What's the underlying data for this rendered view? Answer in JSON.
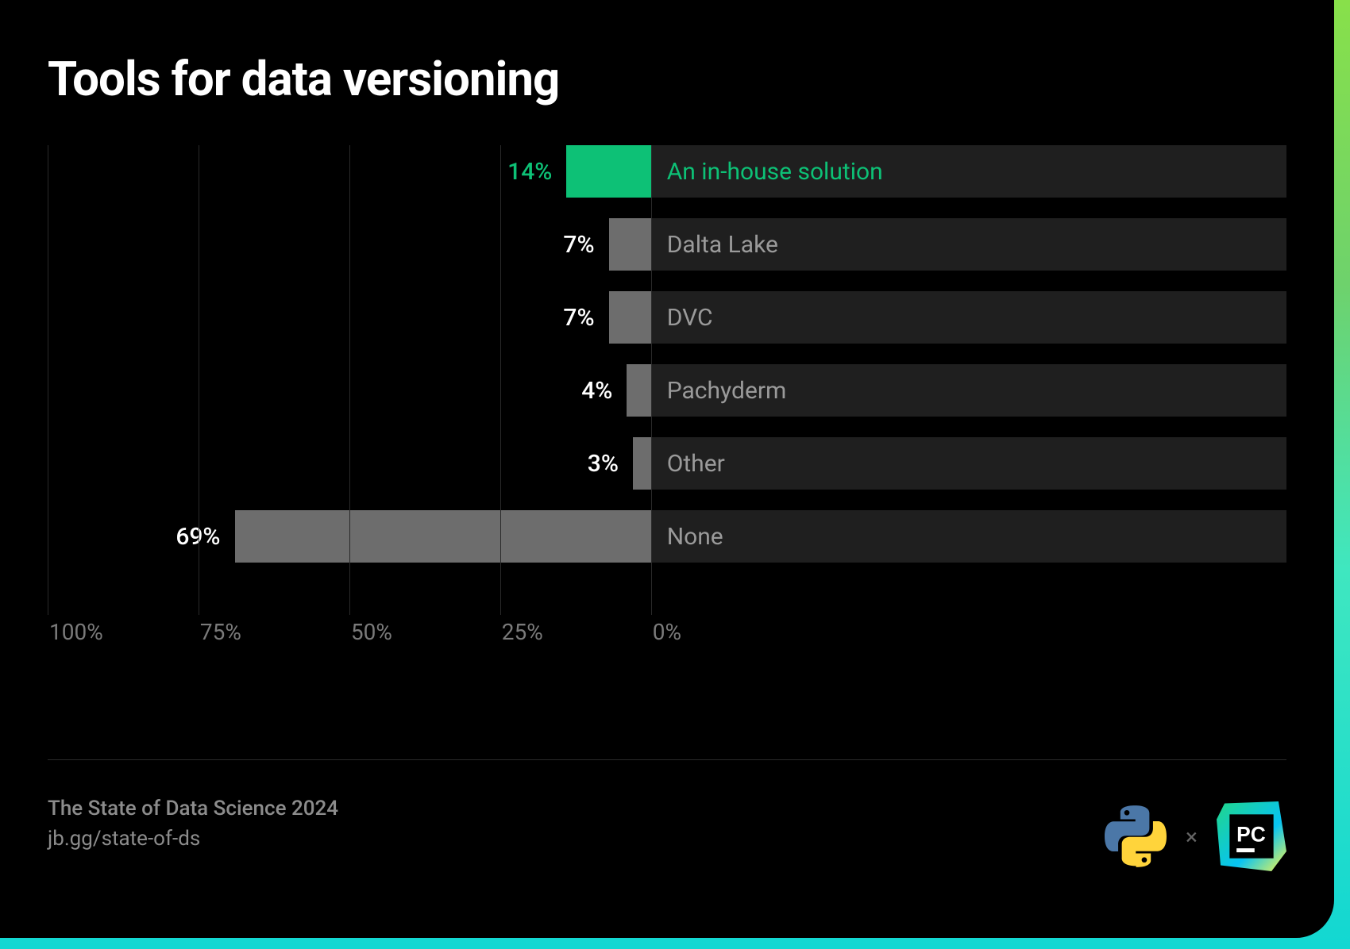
{
  "title": "Tools for data versioning",
  "footer": {
    "line1": "The State of Data Science 2024",
    "line2": "jb.gg/state-of-ds"
  },
  "logos": {
    "cross": "×",
    "python": "python-icon",
    "pycharm": "pycharm-icon"
  },
  "axis_ticks": [
    {
      "label": "100%",
      "position": 0
    },
    {
      "label": "75%",
      "position": 25
    },
    {
      "label": "50%",
      "position": 50
    },
    {
      "label": "25%",
      "position": 75
    },
    {
      "label": "0%",
      "position": 100
    }
  ],
  "chart_data": {
    "type": "bar",
    "orientation": "horizontal-reversed",
    "title": "Tools for data versioning",
    "xlabel": "",
    "ylabel": "",
    "xlim": [
      0,
      100
    ],
    "categories": [
      "An in-house solution",
      "Dalta Lake",
      "DVC",
      "Pachyderm",
      "Other",
      "None"
    ],
    "values": [
      14,
      7,
      7,
      4,
      3,
      69
    ],
    "highlight_index": 0,
    "value_suffix": "%"
  }
}
